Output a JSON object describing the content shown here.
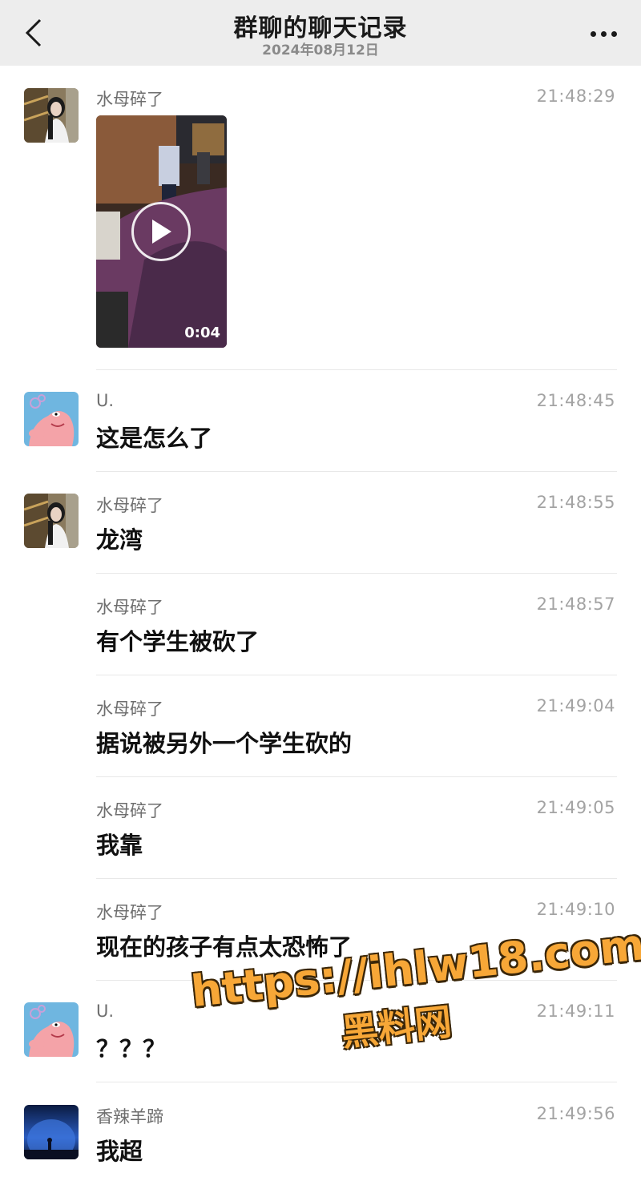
{
  "header": {
    "title": "群聊的聊天记录",
    "date": "2024年08月12日",
    "back_icon": "chevron-left-icon",
    "more_icon": "more-icon"
  },
  "messages": [
    {
      "sender": "水母碎了",
      "time": "21:48:29",
      "type": "video",
      "duration": "0:04",
      "avatar": "girl-photo"
    },
    {
      "sender": "U.",
      "time": "21:48:45",
      "text": "这是怎么了",
      "avatar": "patrick-cartoon"
    },
    {
      "sender": "水母碎了",
      "time": "21:48:55",
      "text": "龙湾",
      "avatar": "girl-photo"
    },
    {
      "sender": "水母碎了",
      "time": "21:48:57",
      "text": "有个学生被砍了"
    },
    {
      "sender": "水母碎了",
      "time": "21:49:04",
      "text": "据说被另外一个学生砍的"
    },
    {
      "sender": "水母碎了",
      "time": "21:49:05",
      "text": "我靠"
    },
    {
      "sender": "水母碎了",
      "time": "21:49:10",
      "text": "现在的孩子有点太恐怖了"
    },
    {
      "sender": "U.",
      "time": "21:49:11",
      "text": "？？？",
      "avatar": "patrick-cartoon"
    },
    {
      "sender": "香辣羊蹄",
      "time": "21:49:56",
      "text": "我超",
      "avatar": "night-sky-photo"
    }
  ],
  "watermark": {
    "url": "https://ihlw18.com",
    "name": "黑料网"
  }
}
